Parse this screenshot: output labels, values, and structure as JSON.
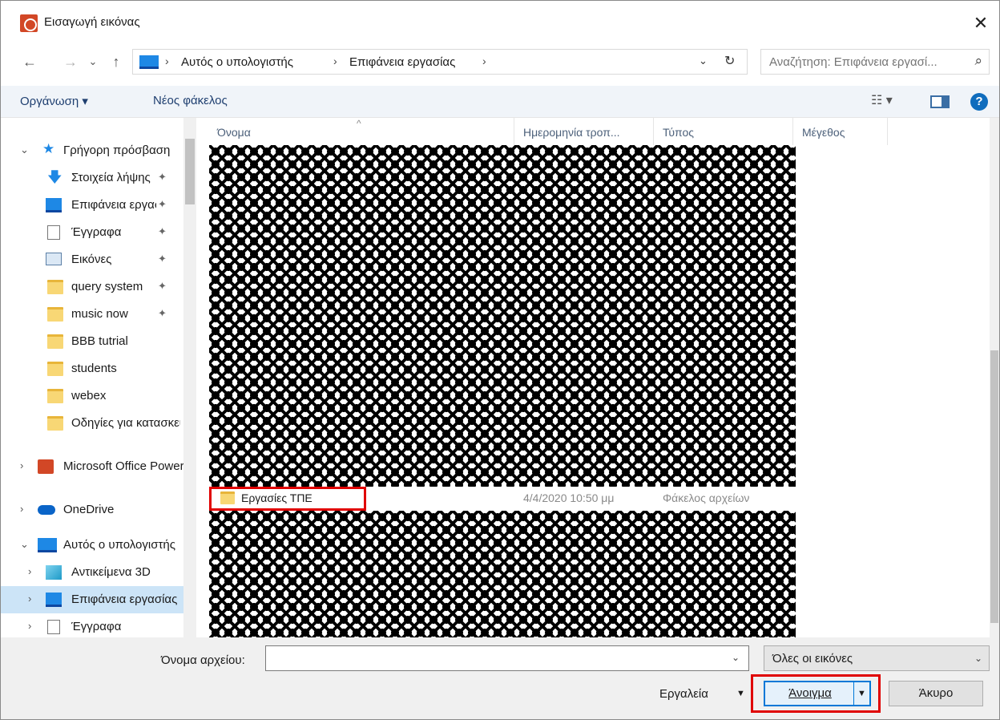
{
  "window": {
    "title": "Εισαγωγή εικόνας",
    "close_glyph": "✕"
  },
  "nav": {
    "back_glyph": "←",
    "forward_glyph": "→",
    "recent_glyph": "⌄",
    "up_glyph": "↑",
    "breadcrumb": [
      "Αυτός ο υπολογιστής",
      "Επιφάνεια εργασίας"
    ],
    "separator": "›",
    "dropdown_glyph": "⌄",
    "refresh_glyph": "↻",
    "search_placeholder": "Αναζήτηση: Επιφάνεια εργασί...",
    "search_glyph": "⌕"
  },
  "toolbar": {
    "organize_label": "Οργάνωση ▾",
    "new_folder_label": "Νέος φάκελος",
    "view_glyph": "☷ ▾",
    "help_glyph": "?"
  },
  "tree": {
    "quick_access": "Γρήγορη πρόσβαση",
    "items": [
      {
        "label": "Στοιχεία λήψης",
        "pinned": true
      },
      {
        "label": "Επιφάνεια εργασίας",
        "pinned": true
      },
      {
        "label": "Έγγραφα",
        "pinned": true
      },
      {
        "label": "Εικόνες",
        "pinned": true
      },
      {
        "label": "query system",
        "pinned": true
      },
      {
        "label": "music now",
        "pinned": true
      },
      {
        "label": "BBB tutrial"
      },
      {
        "label": "students"
      },
      {
        "label": "webex"
      },
      {
        "label": "Οδηγίες για κατασκευή"
      }
    ],
    "office": "Microsoft Office PowerPoint",
    "onedrive": "OneDrive",
    "this_pc": "Αυτός ο υπολογιστής",
    "pc_children": [
      "Αντικείμενα 3D",
      "Επιφάνεια εργασίας",
      "Έγγραφα"
    ],
    "pin_glyph": "✦",
    "collapsed_glyph": "›",
    "expanded_glyph": "⌄"
  },
  "columns": {
    "name": "Όνομα",
    "date": "Ημερομηνία τροπ...",
    "type": "Τύπος",
    "size": "Μέγεθος",
    "sort_glyph": "^"
  },
  "files": [
    {
      "name": "Εργασίες ΤΠΕ",
      "date": "4/4/2020 10:50 μμ",
      "type": "Φάκελος αρχείων",
      "size": ""
    }
  ],
  "bottom": {
    "filename_label": "Όνομα αρχείου:",
    "filename_value": "",
    "dropdown_glyph": "⌄",
    "filetype": "Όλες οι εικόνες",
    "tools_label": "Εργαλεία",
    "tools_arrow": "▼",
    "open_label": "Άνοιγμα",
    "open_split": "▼",
    "cancel_label": "Άκυρο"
  },
  "colors": {
    "highlight": "#e00000",
    "accent": "#0078d7",
    "selected": "#cce4f7"
  }
}
